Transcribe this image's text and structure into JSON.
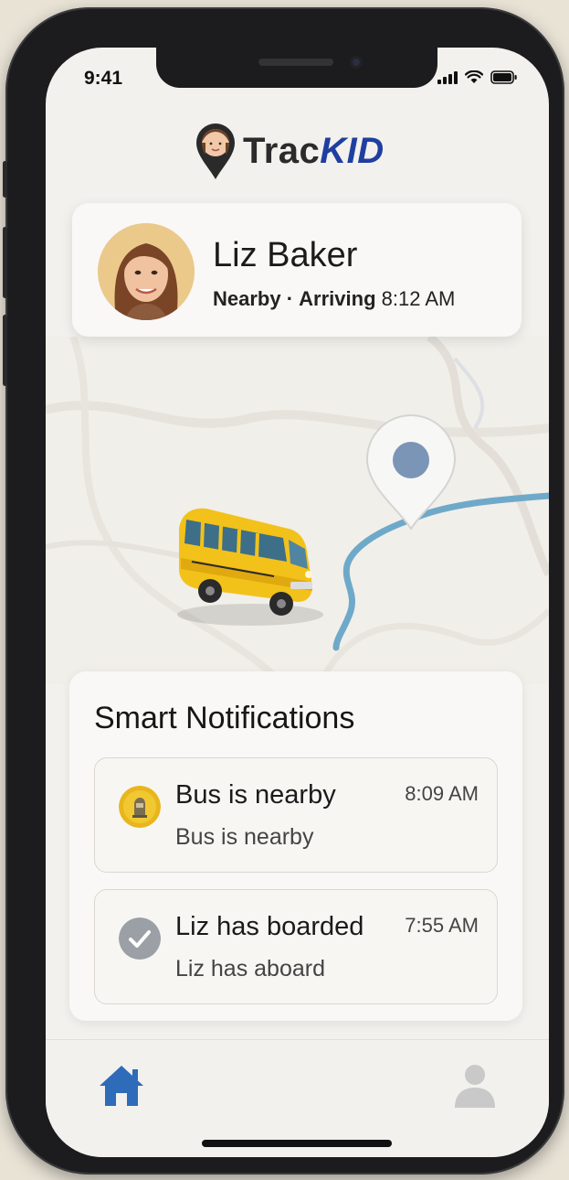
{
  "status_bar": {
    "time": "9:41"
  },
  "app": {
    "logo_text_part1": "Trac",
    "logo_text_part2": "KID"
  },
  "profile": {
    "name": "Liz Baker",
    "status": "Nearby",
    "separator": "·",
    "arrival_label": "Arriving",
    "arrival_time": "8:12 AM"
  },
  "notifications": {
    "title": "Smart Notifications",
    "items": [
      {
        "title": "Bus is nearby",
        "time": "8:09 AM",
        "body": "Bus is nearby",
        "icon": "bus-alert-icon"
      },
      {
        "title": "Liz has boarded",
        "time": "7:55 AM",
        "body": "Liz has aboard",
        "icon": "check-circle-icon"
      }
    ]
  },
  "tabbar": {
    "items": [
      {
        "icon": "home-icon",
        "active": true
      },
      {
        "icon": "profile-icon",
        "active": false
      }
    ]
  },
  "colors": {
    "accent": "#2e6bb8",
    "logo_blue": "#1f3fa0",
    "route": "#6fa9c9",
    "bus_yellow": "#f2c21a",
    "background": "#f3f1ed"
  }
}
